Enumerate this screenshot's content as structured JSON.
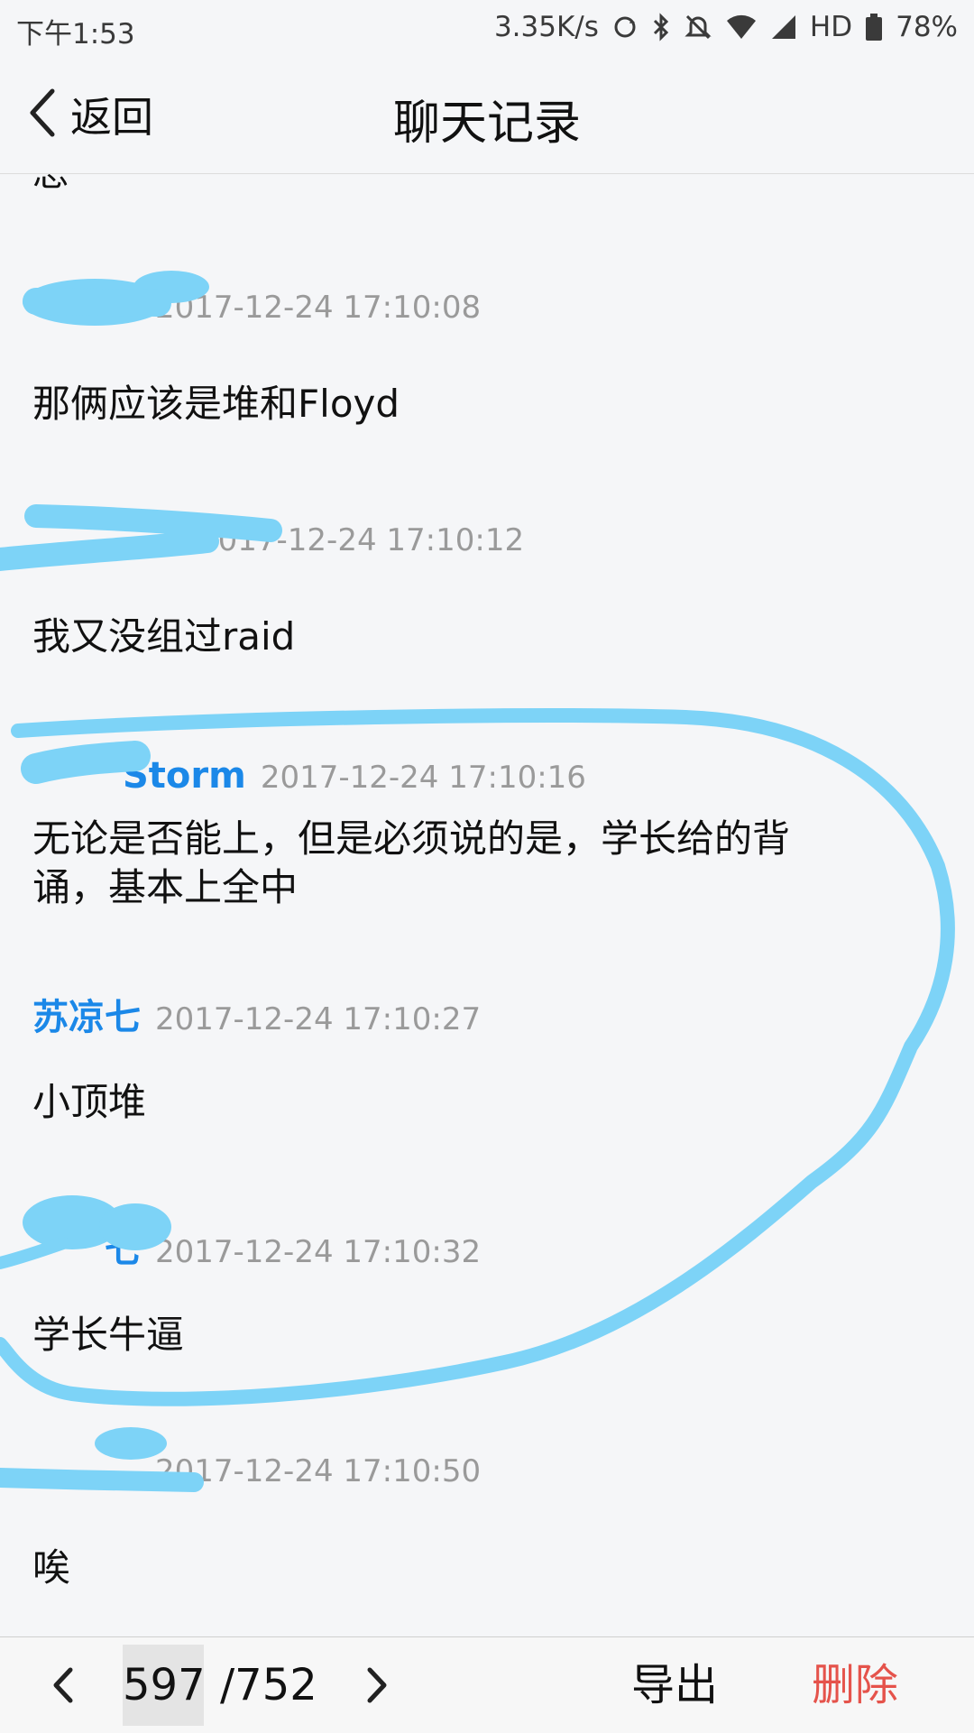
{
  "status_bar": {
    "time": "下午1:53",
    "network_speed": "3.35K/s",
    "hd_label": "HD",
    "battery": "78%"
  },
  "header": {
    "back_label": "返回",
    "title": "聊天记录"
  },
  "messages": {
    "partial_char": "总",
    "items": [
      {
        "sender": "",
        "time": "2017-12-24 17:10:08",
        "text": "那俩应该是堆和Floyd"
      },
      {
        "sender": "",
        "time": "2017-12-24 17:10:12",
        "text": "我又没组过raid"
      },
      {
        "sender": "Storm",
        "time": "2017-12-24 17:10:16",
        "text": "无论是否能上，但是必须说的是，学长给的背诵，基本上全中"
      },
      {
        "sender": "苏凉七",
        "time": "2017-12-24 17:10:27",
        "text": "小顶堆"
      },
      {
        "sender": "七",
        "time": "2017-12-24 17:10:32",
        "text": "学长牛逼"
      },
      {
        "sender": "",
        "time": "2017-12-24 17:10:50",
        "text": "唉"
      }
    ]
  },
  "footer": {
    "current_page": "597",
    "total_pages": "/752",
    "export_label": "导出",
    "delete_label": "删除"
  },
  "colors": {
    "sender_blue": "#1b88e8",
    "delete_red": "#e5534b",
    "scribble": "#7dd3f7"
  }
}
